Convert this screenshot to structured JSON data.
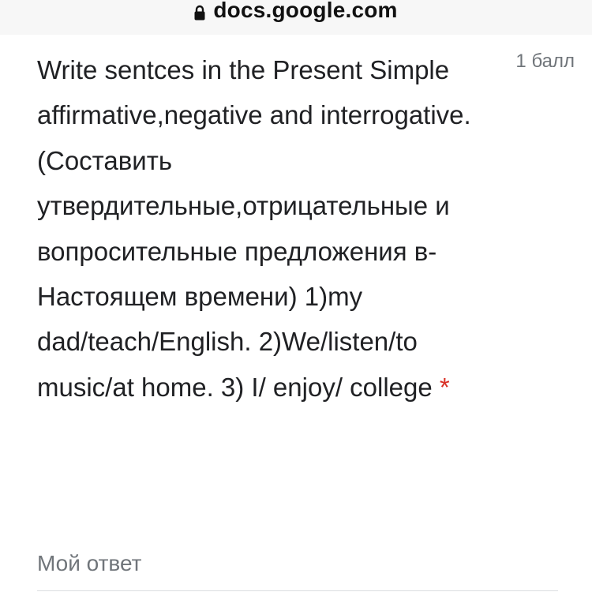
{
  "browser": {
    "url": "docs.google.com"
  },
  "question": {
    "title": "Write sentces in the Present Simple affirmative,negative and interrogative. (Составить утвердительные,отрицательные и вопросительные предложения в-Настоящем времени) 1)my dad/teach/English. 2)We/listen/to music/at home. 3) I/ enjoy/ college",
    "required_marker": "*",
    "points": "1 балл"
  },
  "answer": {
    "placeholder": "Мой ответ"
  }
}
